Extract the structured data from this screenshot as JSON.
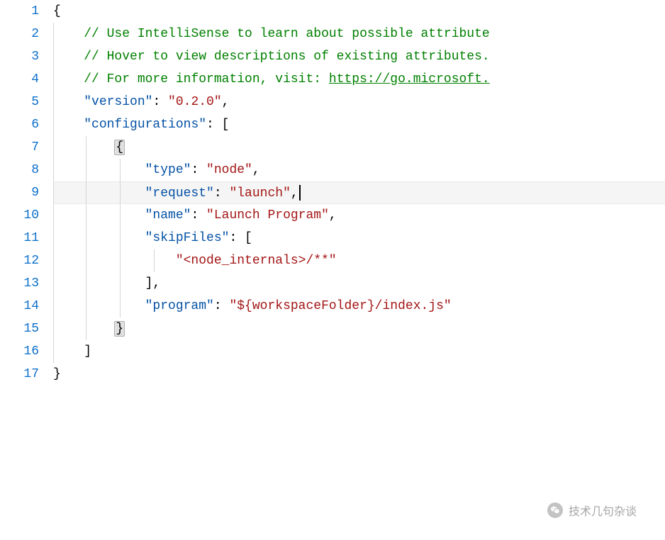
{
  "lineCount": 17,
  "activeLine": 9,
  "code": {
    "comment1": "// Use IntelliSense to learn about possible attribute",
    "comment2": "// Hover to view descriptions of existing attributes.",
    "comment3_prefix": "// For more information, visit: ",
    "comment3_link": "https://go.microsoft.",
    "version_key": "\"version\"",
    "version_val": "\"0.2.0\"",
    "configurations_key": "\"configurations\"",
    "type_key": "\"type\"",
    "type_val": "\"node\"",
    "request_key": "\"request\"",
    "request_val": "\"launch\"",
    "name_key": "\"name\"",
    "name_val": "\"Launch Program\"",
    "skipFiles_key": "\"skipFiles\"",
    "skipFiles_val": "\"<node_internals>/**\"",
    "program_key": "\"program\"",
    "program_val": "\"${workspaceFolder}/index.js\""
  },
  "watermark": {
    "text": "技术几句杂谈"
  }
}
